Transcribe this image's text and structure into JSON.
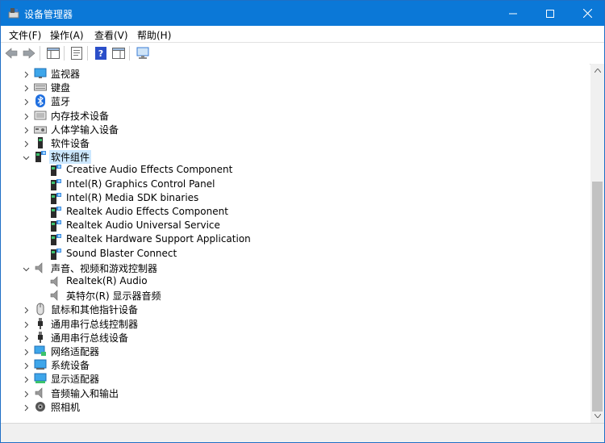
{
  "window": {
    "title": "设备管理器"
  },
  "menu": [
    "文件(F)",
    "操作(A)",
    "查看(V)",
    "帮助(H)"
  ],
  "tree": [
    {
      "label": "监视器",
      "expanded": false,
      "level": 0,
      "icon": "monitor-icon"
    },
    {
      "label": "键盘",
      "expanded": false,
      "level": 0,
      "icon": "keyboard-icon"
    },
    {
      "label": "蓝牙",
      "expanded": false,
      "level": 0,
      "icon": "bluetooth-icon"
    },
    {
      "label": "内存技术设备",
      "expanded": false,
      "level": 0,
      "icon": "memory-icon"
    },
    {
      "label": "人体学输入设备",
      "expanded": false,
      "level": 0,
      "icon": "hid-icon"
    },
    {
      "label": "软件设备",
      "expanded": false,
      "level": 0,
      "icon": "software-device-icon"
    },
    {
      "label": "软件组件",
      "expanded": true,
      "level": 0,
      "icon": "software-component-icon",
      "selected": true
    },
    {
      "label": "Creative Audio Effects Component",
      "level": 1,
      "icon": "software-component-icon"
    },
    {
      "label": "Intel(R) Graphics Control Panel",
      "level": 1,
      "icon": "software-component-icon"
    },
    {
      "label": "Intel(R) Media SDK binaries",
      "level": 1,
      "icon": "software-component-icon"
    },
    {
      "label": "Realtek Audio Effects Component",
      "level": 1,
      "icon": "software-component-icon"
    },
    {
      "label": "Realtek Audio Universal Service",
      "level": 1,
      "icon": "software-component-icon"
    },
    {
      "label": "Realtek Hardware Support Application",
      "level": 1,
      "icon": "software-component-icon"
    },
    {
      "label": "Sound Blaster Connect",
      "level": 1,
      "icon": "software-component-icon"
    },
    {
      "label": "声音、视频和游戏控制器",
      "expanded": true,
      "level": 0,
      "icon": "speaker-icon"
    },
    {
      "label": "Realtek(R) Audio",
      "level": 1,
      "icon": "speaker-icon"
    },
    {
      "label": "英特尔(R) 显示器音频",
      "level": 1,
      "icon": "speaker-icon"
    },
    {
      "label": "鼠标和其他指针设备",
      "expanded": false,
      "level": 0,
      "icon": "mouse-icon"
    },
    {
      "label": "通用串行总线控制器",
      "expanded": false,
      "level": 0,
      "icon": "usb-icon"
    },
    {
      "label": "通用串行总线设备",
      "expanded": false,
      "level": 0,
      "icon": "usb-icon"
    },
    {
      "label": "网络适配器",
      "expanded": false,
      "level": 0,
      "icon": "network-icon"
    },
    {
      "label": "系统设备",
      "expanded": false,
      "level": 0,
      "icon": "system-device-icon"
    },
    {
      "label": "显示适配器",
      "expanded": false,
      "level": 0,
      "icon": "display-adapter-icon"
    },
    {
      "label": "音频输入和输出",
      "expanded": false,
      "level": 0,
      "icon": "speaker-icon"
    },
    {
      "label": "照相机",
      "expanded": false,
      "level": 0,
      "icon": "camera-icon"
    }
  ],
  "colors": {
    "titlebar": "#0b78d7",
    "selection": "#cce8ff"
  }
}
